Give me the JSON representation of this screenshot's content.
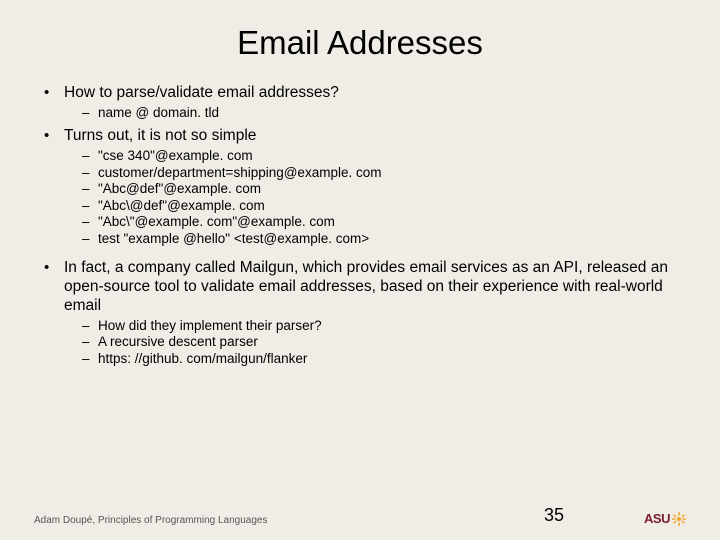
{
  "title": "Email Addresses",
  "bullets": {
    "b1": "How to parse/validate email addresses?",
    "b1_sub": {
      "s1": "name @ domain. tld"
    },
    "b2": "Turns out, it is not so simple",
    "b2_sub": {
      "s1": "\"cse 340\"@example. com",
      "s2": "customer/department=shipping@example. com",
      "s3": "\"Abc@def\"@example. com",
      "s4": "\"Abc\\@def\"@example. com",
      "s5": "\"Abc\\\"@example. com\"@example. com",
      "s6": "test \"example @hello\" <test@example. com>"
    },
    "b3": "In fact, a company called Mailgun, which provides email services as an API, released an open-source tool to validate email addresses, based on their experience with real-world email",
    "b3_sub": {
      "s1": "How did they implement their parser?",
      "s2": "A recursive descent parser",
      "s3": "https: //github. com/mailgun/flanker"
    }
  },
  "footer": {
    "credit": "Adam Doupé, Principles of Programming Languages",
    "page": "35",
    "logo_text": "ASU"
  }
}
